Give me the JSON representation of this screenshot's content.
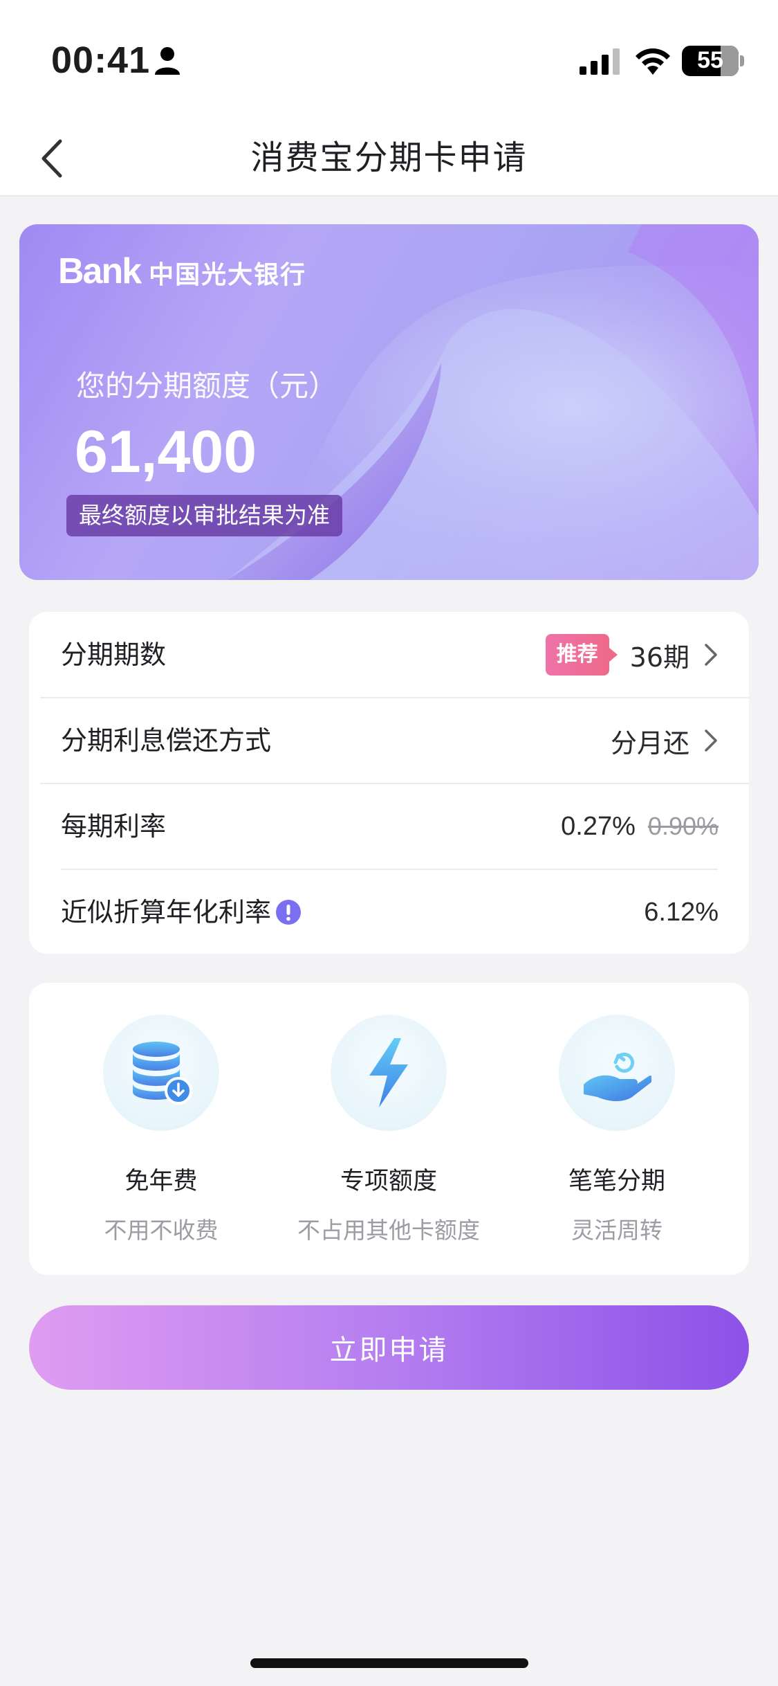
{
  "status_bar": {
    "time": "00:41",
    "battery": "55"
  },
  "nav": {
    "title": "消费宝分期卡申请"
  },
  "hero": {
    "logo_en": "Bank",
    "logo_cn": "中国光大银行",
    "limit_label": "您的分期额度（元）",
    "limit_value": "61,400",
    "limit_note": "最终额度以审批结果为准"
  },
  "settings": {
    "periods": {
      "label": "分期期数",
      "tag": "推荐",
      "value": "36期"
    },
    "repayment": {
      "label": "分期利息偿还方式",
      "value": "分月还"
    },
    "rate": {
      "label": "每期利率",
      "value": "0.27%",
      "original": "0.90%"
    },
    "apr": {
      "label": "近似折算年化利率",
      "value": "6.12%"
    }
  },
  "features": [
    {
      "title": "免年费",
      "subtitle": "不用不收费",
      "icon": "database-download-icon"
    },
    {
      "title": "专项额度",
      "subtitle": "不占用其他卡额度",
      "icon": "lightning-icon"
    },
    {
      "title": "笔笔分期",
      "subtitle": "灵活周转",
      "icon": "hand-refresh-icon"
    }
  ],
  "apply_button": "立即申请",
  "colors": {
    "accent_start": "#df9cf1",
    "accent_end": "#8c52e8",
    "tag": "#ee6a8a",
    "info": "#7a6ff0"
  }
}
